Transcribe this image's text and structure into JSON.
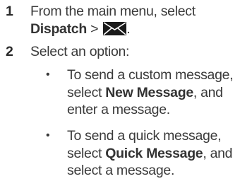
{
  "steps": [
    {
      "number": "1",
      "text_pre": "From the main menu, select",
      "bold": "Dispatch",
      "separator": " > ",
      "icon": "envelope-icon",
      "end": "."
    },
    {
      "number": "2",
      "text": "Select an option:"
    }
  ],
  "bullets": [
    {
      "symbol": "•",
      "pre": "To send a custom message, select ",
      "bold": "New Message",
      "post": ", and enter a message."
    },
    {
      "symbol": "•",
      "pre": "To send a quick message, select ",
      "bold": "Quick Message",
      "post": ", and select a message."
    }
  ]
}
